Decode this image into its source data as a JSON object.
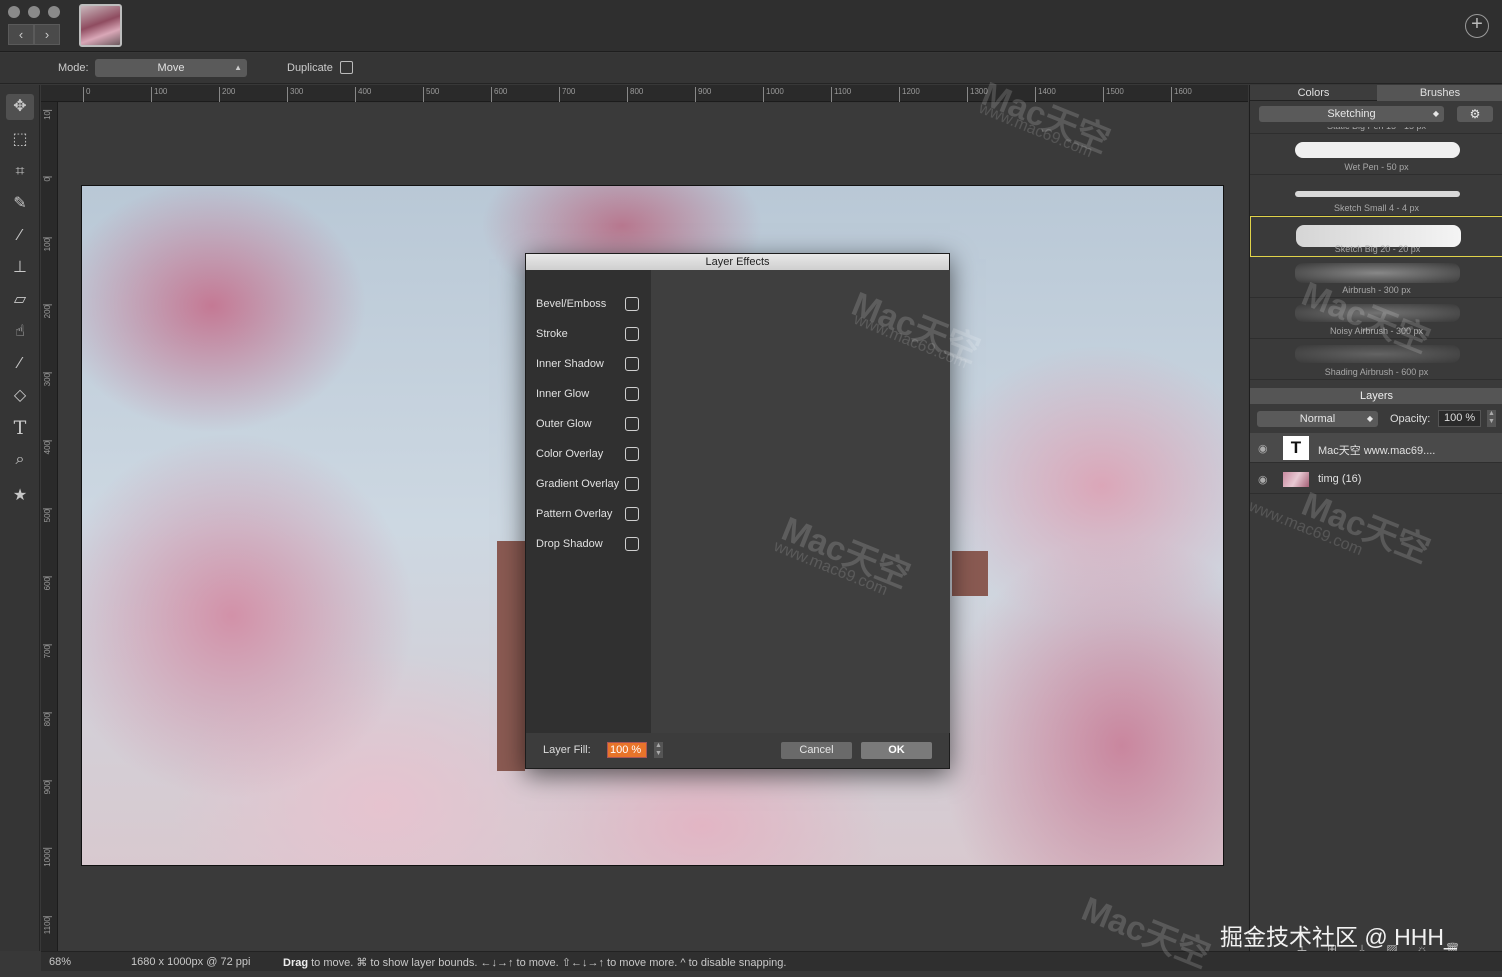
{
  "options": {
    "mode_label": "Mode:",
    "mode_value": "Move",
    "duplicate_label": "Duplicate"
  },
  "toolbar": [
    "move-tool",
    "marquee-tool",
    "crop-tool",
    "eyedropper-tool",
    "brush-tool",
    "stamp-tool",
    "eraser-tool",
    "smudge-tool",
    "paint-tool",
    "fill-tool",
    "text-tool",
    "zoom-tool",
    "favorites-tool"
  ],
  "ruler": {
    "top": [
      "0",
      "100",
      "200",
      "300",
      "400",
      "500",
      "600",
      "700",
      "800",
      "900",
      "1000",
      "1100",
      "1200",
      "1300",
      "1400",
      "1500",
      "1600"
    ],
    "left": [
      "10",
      "0",
      "100",
      "200",
      "300",
      "400",
      "500",
      "600",
      "700",
      "800",
      "900",
      "1000",
      "1100"
    ]
  },
  "dialog": {
    "title": "Layer Effects",
    "effects": [
      "Bevel/Emboss",
      "Stroke",
      "Inner Shadow",
      "Inner Glow",
      "Outer Glow",
      "Color Overlay",
      "Gradient Overlay",
      "Pattern Overlay",
      "Drop Shadow"
    ],
    "fill_label": "Layer Fill:",
    "fill_value": "100 %",
    "cancel": "Cancel",
    "ok": "OK"
  },
  "panel": {
    "tab_colors": "Colors",
    "tab_brushes": "Brushes",
    "brush_set": "Sketching",
    "brushes": [
      "Static Big Pen 15 - 15 px",
      "Wet Pen - 50 px",
      "Sketch Small 4 - 4 px",
      "Sketch Big 20 - 20 px",
      "Airbrush - 300 px",
      "Noisy Airbrush - 300 px",
      "Shading Airbrush - 600 px"
    ],
    "layers_title": "Layers",
    "blend_mode": "Normal",
    "opacity_label": "Opacity:",
    "opacity_value": "100 %",
    "layers": [
      {
        "name": "Mac天空 www.mac69....",
        "kind": "text",
        "thumb": "T"
      },
      {
        "name": "timg (16)",
        "kind": "image"
      }
    ]
  },
  "status": {
    "zoom": "68%",
    "doc_size": "1680 x 1000px @ 72 ppi",
    "hint_bold": "Drag",
    "hint_rest": " to move.  ⌘ to show layer bounds.  ←↓→↑ to move.  ⇧←↓→↑ to move more.  ^ to disable snapping."
  },
  "watermark": {
    "brand": "Mac天空",
    "url": "www.mac69.com",
    "credit": "掘金技术社区 @ HHH_"
  },
  "colors": {
    "accent_fill": "#e8742a",
    "selected_brush": "#e0d34a"
  }
}
